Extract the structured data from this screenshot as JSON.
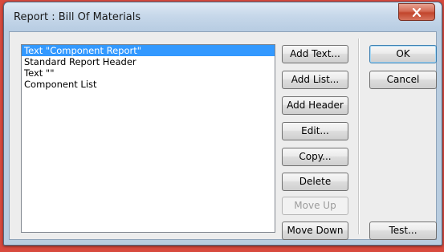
{
  "window": {
    "title": "Report : Bill Of Materials"
  },
  "list": {
    "items": [
      "Text \"Component Report\"",
      "Standard Report Header",
      "Text \"\"",
      "Component List"
    ],
    "selected_index": 0
  },
  "actions": {
    "add_text": "Add Text...",
    "add_list": "Add List...",
    "add_header": "Add Header",
    "edit": "Edit...",
    "copy": "Copy...",
    "delete": "Delete",
    "move_up": "Move Up",
    "move_down": "Move Down"
  },
  "dialog_buttons": {
    "ok": "OK",
    "cancel": "Cancel",
    "test": "Test..."
  },
  "colors": {
    "selection": "#3399ff",
    "close_button": "#c2452c"
  }
}
